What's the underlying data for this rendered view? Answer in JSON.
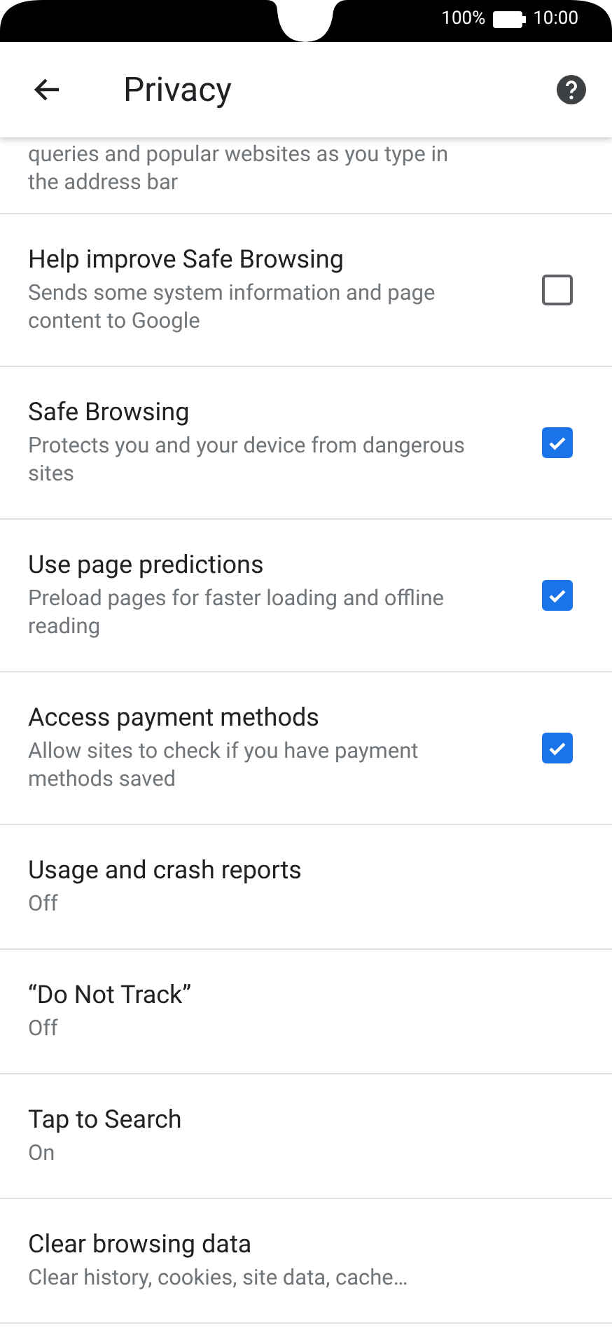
{
  "status_bar": {
    "battery": "100%",
    "time": "10:00"
  },
  "toolbar": {
    "title": "Privacy"
  },
  "partial_item": {
    "description": "queries and popular websites as you type in\nthe address bar"
  },
  "items": [
    {
      "kind": "checkbox",
      "title": "Help improve Safe Browsing",
      "description": "Sends some system information and page content to Google",
      "checked": false
    },
    {
      "kind": "checkbox",
      "title": "Safe Browsing",
      "description": "Protects you and your device from dangerous sites",
      "checked": true
    },
    {
      "kind": "checkbox",
      "title": "Use page predictions",
      "description": "Preload pages for faster loading and offline reading",
      "checked": true
    },
    {
      "kind": "checkbox",
      "title": "Access payment methods",
      "description": "Allow sites to check if you have payment methods saved",
      "checked": true
    },
    {
      "kind": "link",
      "title": "Usage and crash reports",
      "description": "Off"
    },
    {
      "kind": "link",
      "title": "“Do Not Track”",
      "description": "Off"
    },
    {
      "kind": "link",
      "title": "Tap to Search",
      "description": "On"
    },
    {
      "kind": "link",
      "title": "Clear browsing data",
      "description": "Clear history, cookies, site data, cache…"
    }
  ]
}
